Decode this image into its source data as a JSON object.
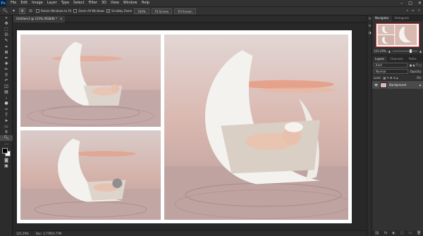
{
  "menubar": {
    "logo": "Ps",
    "items": [
      "File",
      "Edit",
      "Image",
      "Layer",
      "Type",
      "Select",
      "Filter",
      "3D",
      "View",
      "Window",
      "Help"
    ],
    "window_controls": [
      "–",
      "□",
      "✕"
    ]
  },
  "options": {
    "resize_windows_label": "Resize Windows to Fit",
    "zoom_all_windows_label": "Zoom All Windows",
    "scrubby_zoom_label": "Scrubby Zoom",
    "zoom_100": "100%",
    "fit_screen": "Fit Screen",
    "fill_screen": "Fill Screen"
  },
  "document": {
    "tab_title": "Untitled-2 @ 125% (RGB/8) *",
    "tab_close": "×"
  },
  "status": {
    "zoom": "125.29%",
    "doc_size": "Doc: 3.77M/3.77M"
  },
  "panels": {
    "top_tabs": [
      "Navigator",
      "Histogram"
    ],
    "zoom_value": "125.29%",
    "zoom_fraction": 0.7,
    "layer_tabs": [
      "Layers",
      "Channels",
      "Paths"
    ],
    "kind_label": "Kind",
    "blend_mode": "Normal",
    "opacity_label": "Opacity:",
    "lock_label": "Lock:",
    "fill_label": "Fill:",
    "layer_name": "Background",
    "footer_icons": [
      "⛓",
      "fx",
      "◐",
      "▢",
      "▭",
      "🗑"
    ]
  },
  "colors": {
    "accent": "#31a8ff",
    "panel_bg": "#323232",
    "app_bg": "#262626",
    "sky_top": "#e7d2cf",
    "sky_bottom": "#c9a6a0",
    "cloud": "#e99a7d",
    "moon": "#f4f2ef"
  }
}
